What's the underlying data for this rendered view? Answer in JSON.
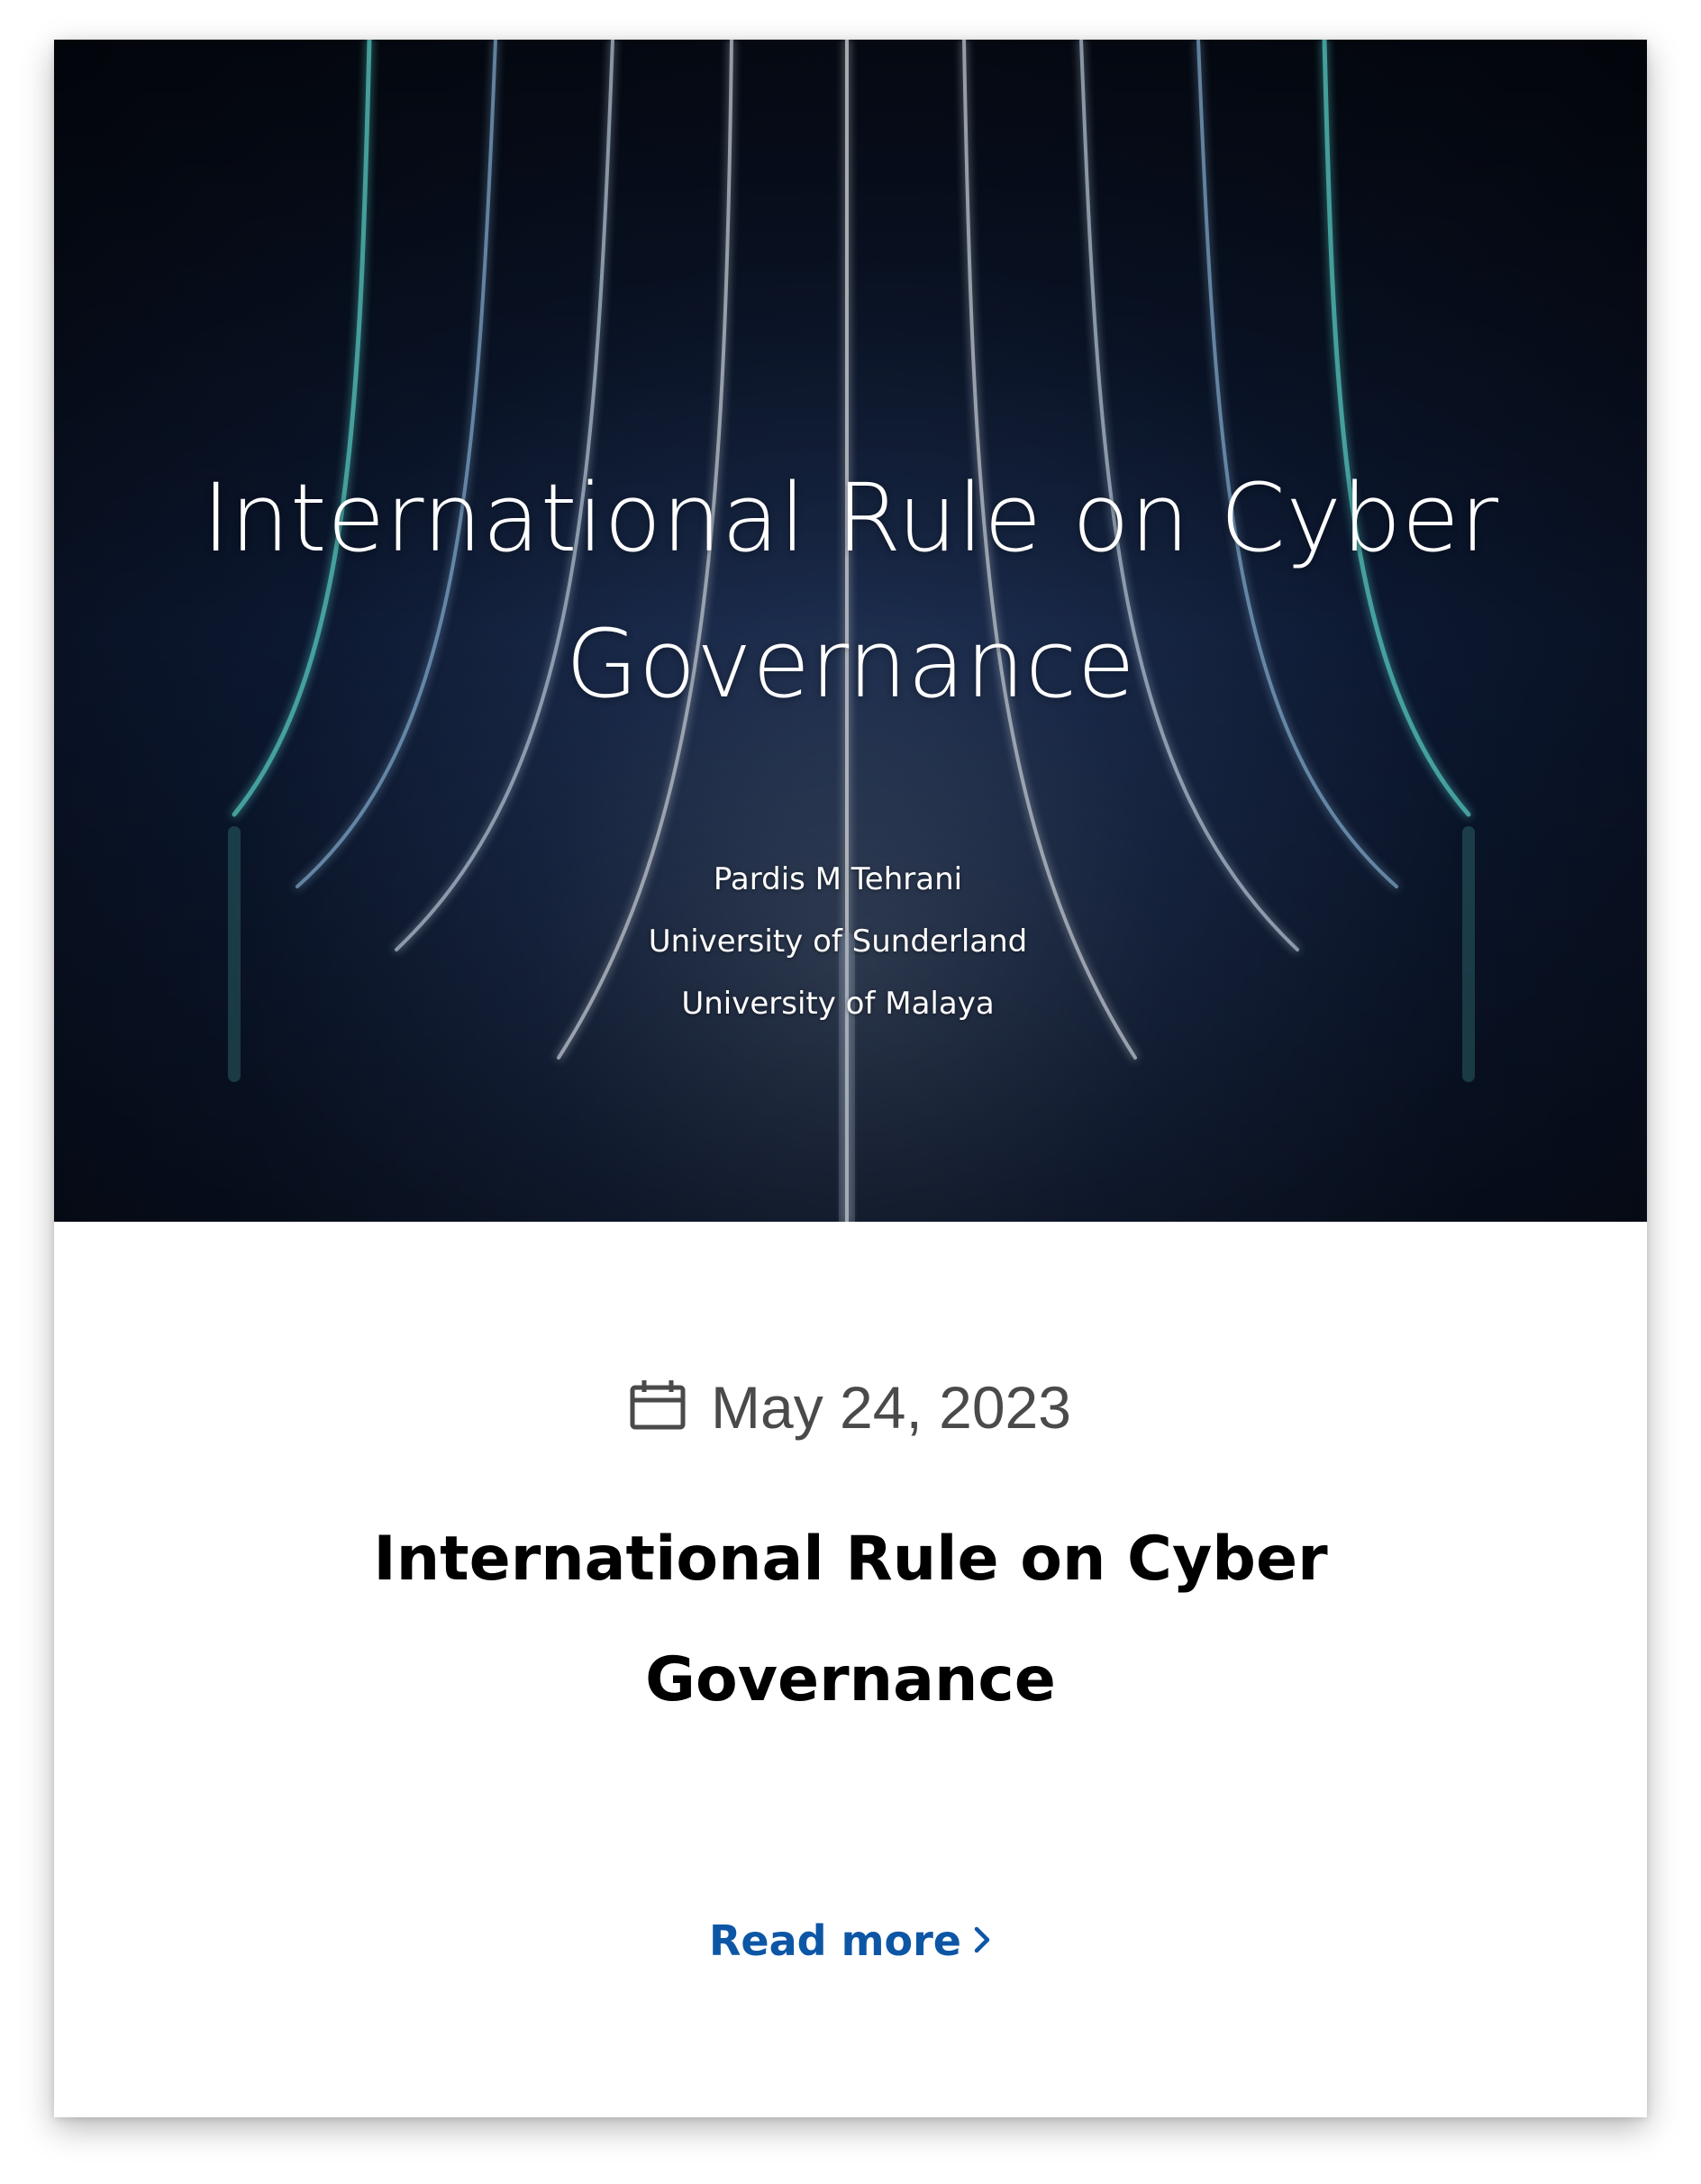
{
  "hero": {
    "title_line1": "International Rule on Cyber",
    "title_line2": "Governance",
    "authors": [
      "Pardis M Tehrani",
      "University of Sunderland",
      "University of Malaya"
    ]
  },
  "post": {
    "date": "May 24, 2023",
    "title_line1": "International Rule on Cyber",
    "title_line2": "Governance",
    "read_more_label": "Read more"
  },
  "colors": {
    "link": "#0d56a6",
    "date_text": "#4a4a4a",
    "title_text": "#000000"
  },
  "icons": {
    "date": "calendar-icon",
    "read_more": "chevron-right-icon"
  }
}
